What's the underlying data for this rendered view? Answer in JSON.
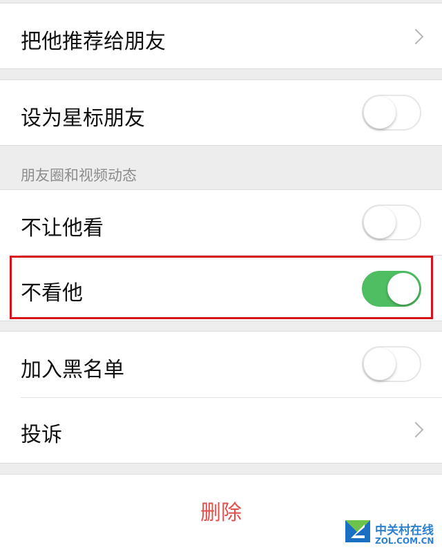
{
  "rows": {
    "recommend": {
      "label": "把他推荐给朋友"
    },
    "star": {
      "label": "设为星标朋友",
      "enabled": false
    },
    "section_title": "朋友圈和视频动态",
    "hide_from": {
      "label": "不让他看",
      "enabled": false
    },
    "block_view": {
      "label": "不看他",
      "enabled": true
    },
    "blacklist": {
      "label": "加入黑名单",
      "enabled": false
    },
    "report": {
      "label": "投诉"
    }
  },
  "delete_label": "删除",
  "watermark": {
    "name": "中关村在线",
    "url": "ZOL.COM.CN"
  },
  "colors": {
    "toggle_on": "#4fbd61",
    "delete_text": "#e0504c",
    "highlight_border": "#d8101b",
    "background": "#ededed"
  }
}
